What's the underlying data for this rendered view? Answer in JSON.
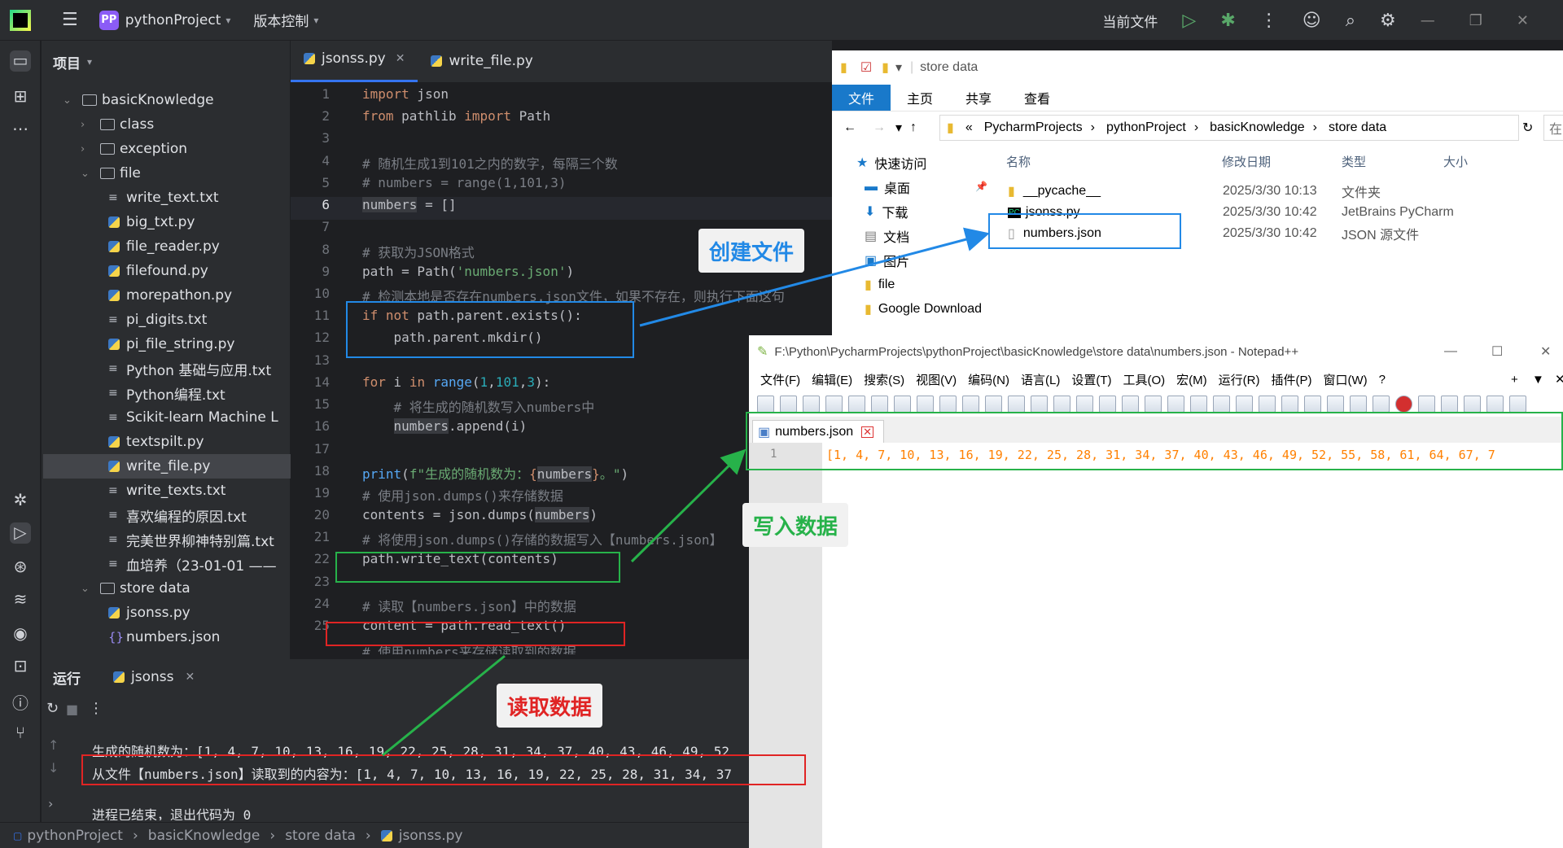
{
  "ide": {
    "project_badge": "PP",
    "project_name": "pythonProject",
    "vcs": "版本控制",
    "current_file": "当前文件"
  },
  "project_panel": {
    "title": "项目",
    "tree": [
      {
        "label": "basicKnowledge",
        "type": "folder",
        "expanded": true
      },
      {
        "label": "class",
        "type": "folder",
        "expanded": false
      },
      {
        "label": "exception",
        "type": "folder",
        "expanded": false
      },
      {
        "label": "file",
        "type": "folder",
        "expanded": true
      },
      {
        "label": "write_text.txt",
        "type": "txt"
      },
      {
        "label": "big_txt.py",
        "type": "py"
      },
      {
        "label": "file_reader.py",
        "type": "py"
      },
      {
        "label": "filefound.py",
        "type": "py"
      },
      {
        "label": "morepathon.py",
        "type": "py"
      },
      {
        "label": "pi_digits.txt",
        "type": "txt"
      },
      {
        "label": "pi_file_string.py",
        "type": "py"
      },
      {
        "label": "Python 基础与应用.txt",
        "type": "txt"
      },
      {
        "label": "Python编程.txt",
        "type": "txt"
      },
      {
        "label": "Scikit-learn Machine L",
        "type": "txt"
      },
      {
        "label": "textspilt.py",
        "type": "py"
      },
      {
        "label": "write_file.py",
        "type": "py",
        "selected": true
      },
      {
        "label": "write_texts.txt",
        "type": "txt"
      },
      {
        "label": "喜欢编程的原因.txt",
        "type": "txt"
      },
      {
        "label": "完美世界柳神特别篇.txt",
        "type": "txt"
      },
      {
        "label": "血培养（23-01-01 ——",
        "type": "txt"
      },
      {
        "label": "store data",
        "type": "folder",
        "expanded": true
      },
      {
        "label": "jsonss.py",
        "type": "py"
      },
      {
        "label": "numbers.json",
        "type": "json"
      }
    ]
  },
  "editor": {
    "tabs": [
      "jsonss.py",
      "write_file.py"
    ],
    "line_numbers": [
      "1",
      "2",
      "3",
      "4",
      "5",
      "6",
      "7",
      "8",
      "9",
      "10",
      "11",
      "12",
      "13",
      "14",
      "15",
      "16",
      "17",
      "18",
      "19",
      "20",
      "21",
      "22",
      "23",
      "24",
      "25"
    ],
    "lines": {
      "l1": "import json",
      "l2": "from pathlib import Path",
      "l4": "# 随机生成1到101之内的数字，每隔三个数",
      "l5": "# numbers = range(1,101,3)",
      "l6": "numbers = []",
      "l8": "# 获取为JSON格式",
      "l9": "path = Path('numbers.json')",
      "l10": "# 检测本地是否存在numbers.json文件，如果不存在，则执行下面这句",
      "l11": "if not path.parent.exists():",
      "l12": "    path.parent.mkdir()",
      "l14": "for i in range(1,101,3):",
      "l15": "    # 将生成的随机数写入numbers中",
      "l16": "    numbers.append(i)",
      "l18": "print(f\"生成的随机数为：{numbers}。\")",
      "l19": "# 使用json.dumps()来存储数据",
      "l20": "contents = json.dumps(numbers)",
      "l21": "# 将使用json.dumps()存储的数据写入【numbers.json】",
      "l22": "path.write_text(contents)",
      "l24": "# 读取【numbers.json】中的数据",
      "l25": "content = path.read_text()",
      "l26": "# 使用numbers来存储读取到的数据"
    }
  },
  "run": {
    "tab_run": "运行",
    "tab_file": "jsonss",
    "output": [
      "生成的随机数为：[1, 4, 7, 10, 13, 16, 19, 22, 25, 28, 31, 34, 37, 40, 43, 46, 49, 52",
      "从文件【numbers.json】读取到的内容为：[1, 4, 7, 10, 13, 16, 19, 22, 25, 28, 31, 34, 37",
      "",
      "进程已结束，退出代码为 0"
    ]
  },
  "status_bar": {
    "crumbs": [
      "pythonProject",
      "basicKnowledge",
      "store data",
      "jsonss.py"
    ]
  },
  "explorer": {
    "title": "store data",
    "ribbon": [
      "文件",
      "主页",
      "共享",
      "查看"
    ],
    "address": [
      "«",
      "PycharmProjects",
      "pythonProject",
      "basicKnowledge",
      "store data"
    ],
    "search_placeholder": "在 sto",
    "nav": [
      "快速访问",
      "桌面",
      "下载",
      "文档",
      "图片",
      "file",
      "Google Download"
    ],
    "columns": [
      "名称",
      "修改日期",
      "类型",
      "大小"
    ],
    "files": [
      {
        "name": "__pycache__",
        "date": "2025/3/30 10:13",
        "type": "文件夹"
      },
      {
        "name": "jsonss.py",
        "date": "2025/3/30 10:42",
        "type": "JetBrains PyCharm"
      },
      {
        "name": "numbers.json",
        "date": "2025/3/30 10:42",
        "type": "JSON 源文件"
      }
    ]
  },
  "notepad": {
    "title": "F:\\Python\\PycharmProjects\\pythonProject\\basicKnowledge\\store data\\numbers.json - Notepad++",
    "menu": [
      "文件(F)",
      "编辑(E)",
      "搜索(S)",
      "视图(V)",
      "编码(N)",
      "语言(L)",
      "设置(T)",
      "工具(O)",
      "宏(M)",
      "运行(R)",
      "插件(P)",
      "窗口(W)",
      "?"
    ],
    "tab": "numbers.json",
    "line_no": "1",
    "content": "[1, 4, 7, 10, 13, 16, 19, 22, 25, 28, 31, 34, 37, 40, 43, 46, 49, 52, 55, 58, 61, 64, 67, 7"
  },
  "annotations": {
    "create_file": "创建文件",
    "write_data": "写入数据",
    "read_data": "读取数据"
  },
  "colors": {
    "red": "#e02424",
    "blue": "#2289e6",
    "green": "#27b24a"
  }
}
